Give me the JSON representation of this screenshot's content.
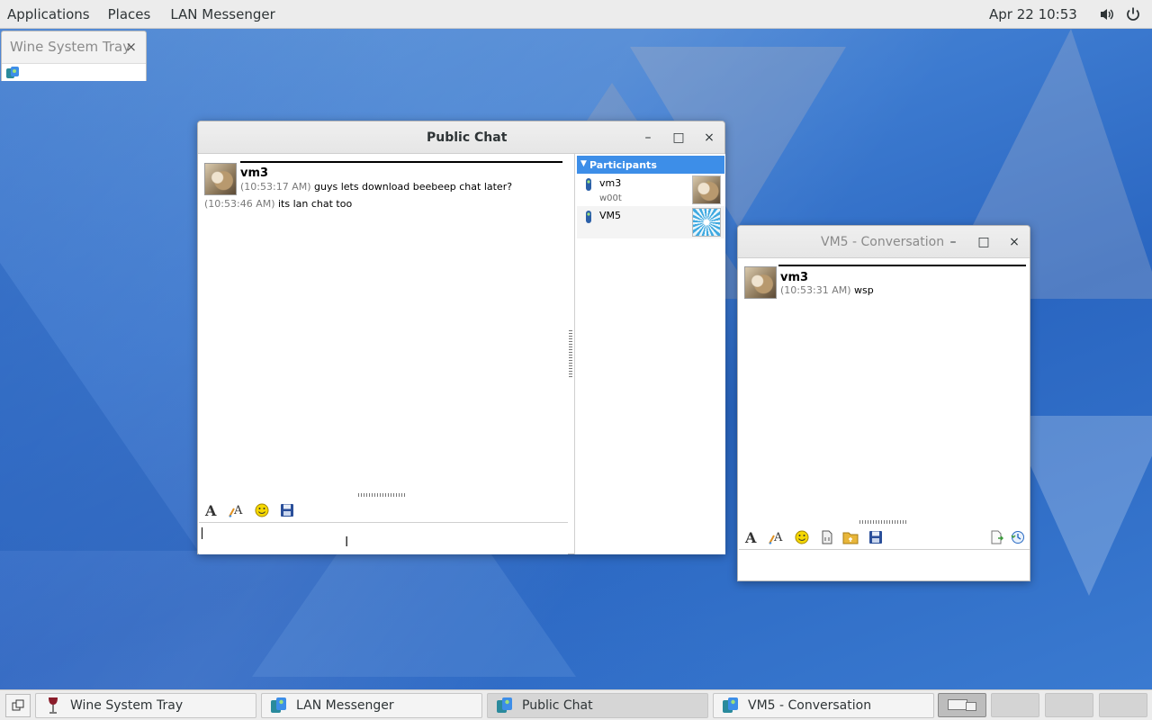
{
  "topbar": {
    "menus": [
      "Applications",
      "Places",
      "LAN Messenger"
    ],
    "clock": "Apr 22  10:53",
    "icons": [
      "volume-icon",
      "power-icon"
    ]
  },
  "wine_tray": {
    "title": "Wine System Tray",
    "close": "×"
  },
  "public_chat": {
    "title": "Public Chat",
    "buttons": {
      "minimize": "–",
      "maximize": "□",
      "close": "×"
    },
    "messages": [
      {
        "sender": "vm3",
        "lines": [
          {
            "time": "(10:53:17 AM)",
            "text": "guys lets download beebeep chat later?"
          },
          {
            "time": "(10:53:46 AM)",
            "text": "its lan chat too"
          }
        ]
      }
    ],
    "toolbar": [
      "font-icon",
      "font-color-icon",
      "emoticon-icon",
      "save-icon"
    ],
    "input_value": "",
    "participants": {
      "header": "Participants",
      "items": [
        {
          "name": "vm3",
          "status": "w00t"
        },
        {
          "name": "VM5",
          "status": ""
        }
      ]
    }
  },
  "vm5_conversation": {
    "title": "VM5 - Conversation",
    "buttons": {
      "minimize": "–",
      "maximize": "□",
      "close": "×"
    },
    "messages": [
      {
        "sender": "vm3",
        "lines": [
          {
            "time": "(10:53:31 AM)",
            "text": "wsp"
          }
        ]
      }
    ],
    "toolbar": [
      "font-icon",
      "font-color-icon",
      "emoticon-icon",
      "file-icon",
      "folder-icon",
      "save-icon",
      "send-file-icon",
      "history-icon"
    ],
    "input_value": ""
  },
  "taskbar": {
    "tasks": [
      {
        "label": "Wine System Tray",
        "active": false
      },
      {
        "label": "LAN Messenger",
        "active": false
      },
      {
        "label": "Public Chat",
        "active": true
      },
      {
        "label": "VM5 - Conversation",
        "active": false
      }
    ],
    "workspaces": 4
  },
  "colors": {
    "participants_header": "#3d8ee8",
    "panel_bg": "#ececec",
    "desktop_accent": "#2f6fc8"
  }
}
